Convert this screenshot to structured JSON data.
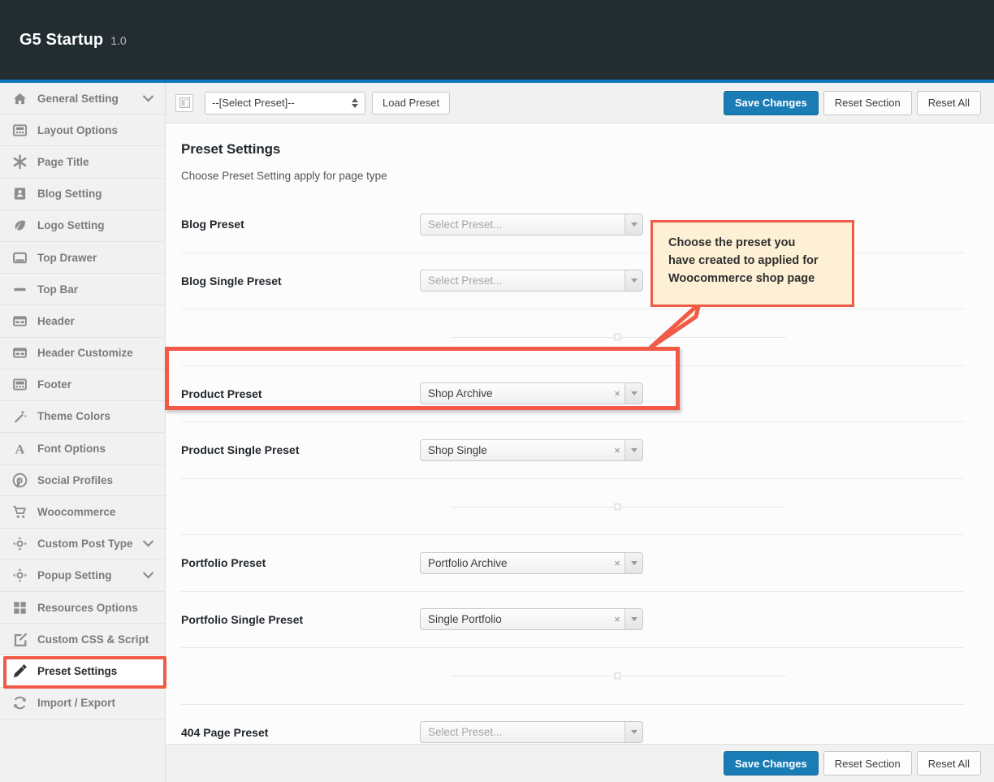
{
  "header": {
    "title": "G5 Startup",
    "version": "1.0"
  },
  "sidebar": {
    "items": [
      {
        "label": "General Setting",
        "icon": "home-icon",
        "chevron": true,
        "active": false
      },
      {
        "label": "Layout Options",
        "icon": "layout-icon",
        "chevron": false,
        "active": false
      },
      {
        "label": "Page Title",
        "icon": "asterisk-icon",
        "chevron": false,
        "active": false
      },
      {
        "label": "Blog Setting",
        "icon": "blog-icon",
        "chevron": false,
        "active": false
      },
      {
        "label": "Logo Setting",
        "icon": "leaf-icon",
        "chevron": false,
        "active": false
      },
      {
        "label": "Top Drawer",
        "icon": "drawer-icon",
        "chevron": false,
        "active": false
      },
      {
        "label": "Top Bar",
        "icon": "bar-icon",
        "chevron": false,
        "active": false
      },
      {
        "label": "Header",
        "icon": "header-icon",
        "chevron": false,
        "active": false
      },
      {
        "label": "Header Customize",
        "icon": "header-icon",
        "chevron": false,
        "active": false
      },
      {
        "label": "Footer",
        "icon": "footer-icon",
        "chevron": false,
        "active": false
      },
      {
        "label": "Theme Colors",
        "icon": "magic-wand-icon",
        "chevron": false,
        "active": false
      },
      {
        "label": "Font Options",
        "icon": "font-a-icon",
        "chevron": false,
        "active": false
      },
      {
        "label": "Social Profiles",
        "icon": "pinterest-icon",
        "chevron": false,
        "active": false
      },
      {
        "label": "Woocommerce",
        "icon": "cart-icon",
        "chevron": false,
        "active": false
      },
      {
        "label": "Custom Post Type",
        "icon": "target-icon",
        "chevron": true,
        "active": false
      },
      {
        "label": "Popup Setting",
        "icon": "target-icon",
        "chevron": true,
        "active": false
      },
      {
        "label": "Resources Options",
        "icon": "grid-icon",
        "chevron": false,
        "active": false
      },
      {
        "label": "Custom CSS & Script",
        "icon": "edit-page-icon",
        "chevron": false,
        "active": false
      },
      {
        "label": "Preset Settings",
        "icon": "pencil-icon",
        "chevron": false,
        "active": true
      },
      {
        "label": "Import / Export",
        "icon": "refresh-icon",
        "chevron": false,
        "active": false
      }
    ]
  },
  "toolbar": {
    "expand_icon": "panel-toggle-icon",
    "preset_select_value": "--[Select Preset]--",
    "load_preset_label": "Load Preset",
    "save_label": "Save Changes",
    "reset_section_label": "Reset Section",
    "reset_all_label": "Reset All"
  },
  "panel": {
    "title": "Preset Settings",
    "subtitle": "Choose Preset Setting apply for page type",
    "fields": [
      {
        "label": "Blog Preset",
        "value": "Select Preset...",
        "empty": true,
        "clear_icon": "clear-x-icon"
      },
      {
        "label": "Blog Single Preset",
        "value": "Select Preset...",
        "empty": true,
        "clear_icon": "clear-x-icon"
      },
      {
        "label": "Product Preset",
        "value": "Shop Archive",
        "empty": false,
        "clear_icon": "clear-x-icon"
      },
      {
        "label": "Product Single Preset",
        "value": "Shop Single",
        "empty": false,
        "clear_icon": "clear-x-icon"
      },
      {
        "label": "Portfolio Preset",
        "value": "Portfolio Archive",
        "empty": false,
        "clear_icon": "clear-x-icon"
      },
      {
        "label": "Portfolio Single Preset",
        "value": "Single Portfolio",
        "empty": false,
        "clear_icon": "clear-x-icon"
      },
      {
        "label": "404 Page Preset",
        "value": "Select Preset...",
        "empty": true,
        "clear_icon": "clear-x-icon"
      }
    ]
  },
  "footer": {
    "save_label": "Save Changes",
    "reset_section_label": "Reset Section",
    "reset_all_label": "Reset All"
  },
  "annotations": {
    "callout_text": "Choose the preset you\nhave created to applied for\nWoocommerce shop page",
    "highlight_color": "#f05a47",
    "callout_background": "#fdf0d5"
  },
  "colors": {
    "header_bg": "#222c31",
    "accent": "#0e76bc",
    "primary_button": "#1a7cb5",
    "sidebar_bg": "#f1f1f1"
  }
}
